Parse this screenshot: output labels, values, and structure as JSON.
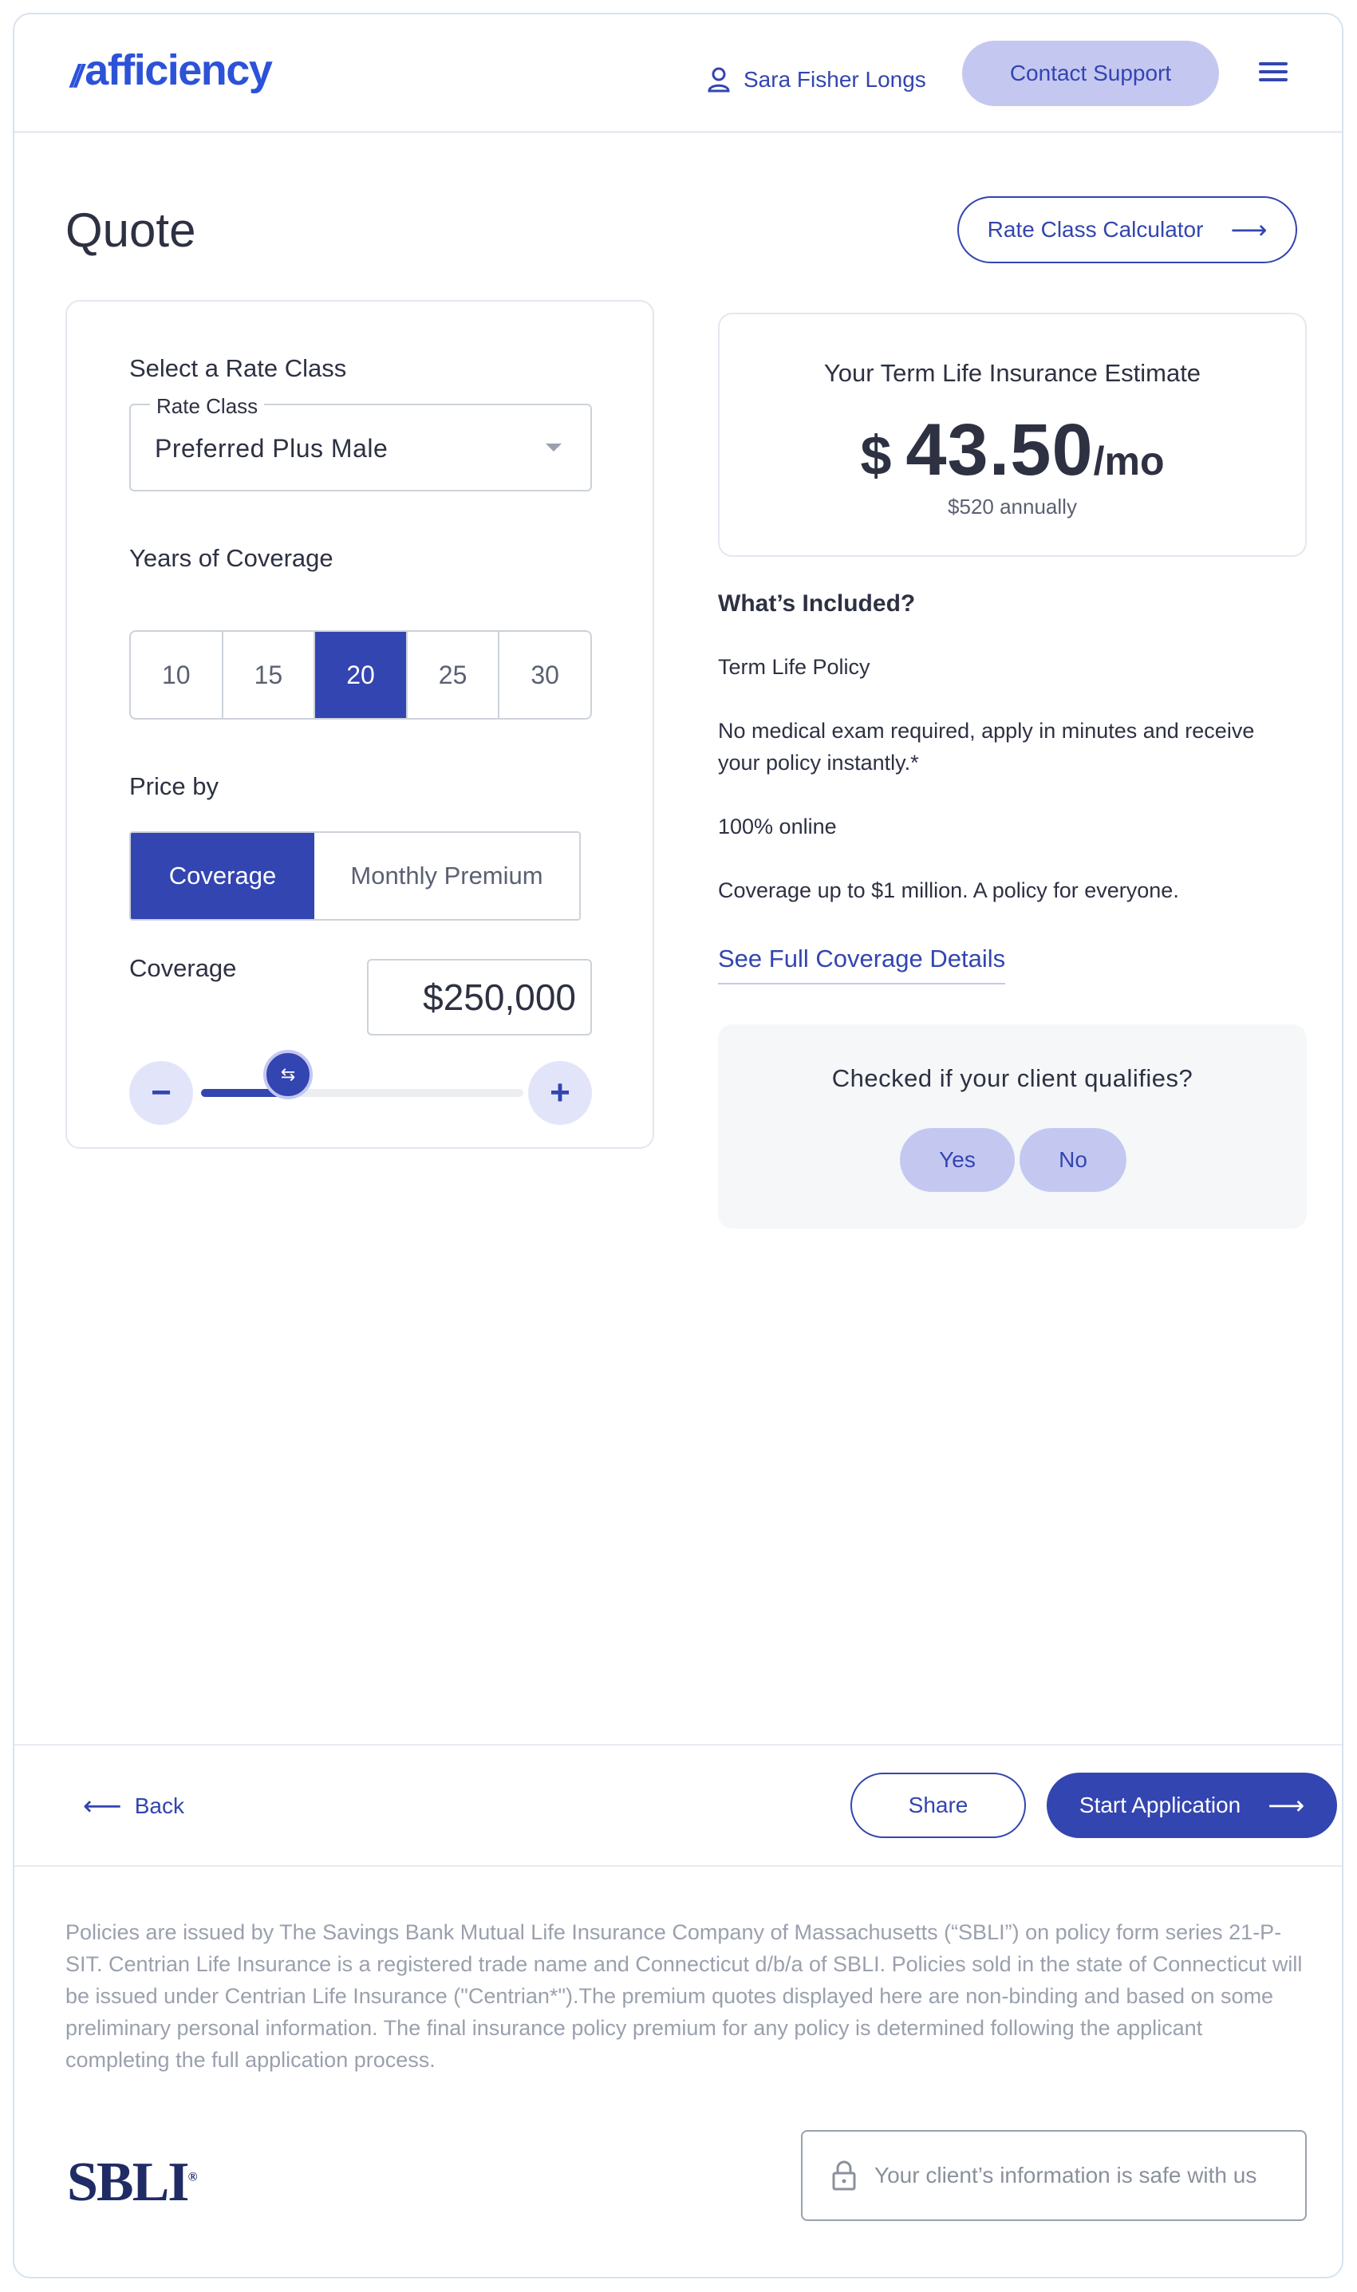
{
  "header": {
    "logo_mark": "//",
    "logo_text": "afficiency",
    "user_name": "Sara Fisher Longs",
    "contact_label": "Contact Support"
  },
  "page": {
    "title": "Quote",
    "rate_class_calculator_label": "Rate Class Calculator"
  },
  "quote_form": {
    "rate_class_heading": "Select a Rate Class",
    "rate_class_field_label": "Rate Class",
    "rate_class_value": "Preferred Plus Male",
    "years_heading": "Years of Coverage",
    "years": [
      "10",
      "15",
      "20",
      "25",
      "30"
    ],
    "years_selected": "20",
    "price_by_heading": "Price by",
    "price_by_options": [
      "Coverage",
      "Monthly Premium"
    ],
    "price_by_selected": "Coverage",
    "coverage_label": "Coverage",
    "coverage_value": "$250,000",
    "slider_fraction": 0.27
  },
  "estimate": {
    "title": "Your Term Life Insurance Estimate",
    "currency": "$",
    "amount": "43.50",
    "unit": "/mo",
    "annual": "$520 annually"
  },
  "included": {
    "title": "What’s Included?",
    "items": [
      "Term Life Policy",
      "No medical exam required, apply in minutes and receive your policy instantly.*",
      "100% online",
      "Coverage up to $1 million. A policy for everyone."
    ],
    "details_link": "See Full Coverage Details"
  },
  "qualify": {
    "question": "Checked if your client qualifies?",
    "yes_label": "Yes",
    "no_label": "No"
  },
  "bottom_bar": {
    "back_label": "Back",
    "share_label": "Share",
    "start_label": "Start Application"
  },
  "footer": {
    "disclaimer": "Policies are issued by The Savings Bank Mutual Life Insurance Company of Massachusetts (“SBLI”) on policy form series 21-P-SIT. Centrian Life Insurance is a registered trade name and Connecticut d/b/a of SBLI. Policies sold in the state of Connecticut will be issued under Centrian Life Insurance (\"Centrian*\").The premium quotes displayed here are non-binding and based on some preliminary personal information. The final insurance policy premium for any policy is determined following the applicant completing the full application process.",
    "brand": "SBLI",
    "brand_mark": "®",
    "safe_text": "Your client’s information is safe with us"
  },
  "colors": {
    "primary": "#3345b0",
    "primary_light": "#c4c8f1",
    "logo_blue": "#2c52d8",
    "text": "#2d3142",
    "muted": "#9aa0ad"
  },
  "icons": {
    "user": "user-icon",
    "menu": "hamburger-menu-icon",
    "arrow_right": "arrow-right-icon",
    "arrow_left": "arrow-left-icon",
    "caret": "caret-down-icon",
    "minus": "minus-icon",
    "plus": "plus-icon",
    "lock": "lock-icon"
  }
}
